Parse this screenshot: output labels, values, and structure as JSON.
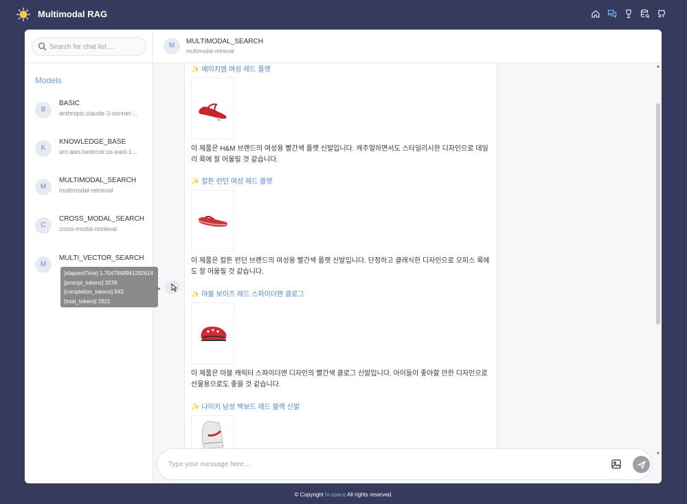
{
  "app": {
    "title": "Multimodal RAG",
    "nav_icons": [
      "home-icon",
      "chat-icon",
      "wine-glass-icon",
      "database-search-icon",
      "github-icon"
    ]
  },
  "sidebar": {
    "search_placeholder": "Search for chat list ...",
    "models_heading": "Models",
    "models": [
      {
        "initial": "B",
        "name": "BASIC",
        "sub": "anthropic.claude-3-sonnet-..."
      },
      {
        "initial": "K",
        "name": "KNOWLEDGE_BASE",
        "sub": "arn:aws:bedrock:us-east-1..."
      },
      {
        "initial": "M",
        "name": "MULTIMODAL_SEARCH",
        "sub": "multimodal-retrieval"
      },
      {
        "initial": "C",
        "name": "CROSS_MODAL_SEARCH",
        "sub": "cross-modal-retrieval"
      },
      {
        "initial": "M",
        "name": "MULTI_VECTOR_SEARCH",
        "sub": ""
      }
    ],
    "tooltip": [
      "[elapsedTime] 1.7047848941292614",
      "[prompt_tokens] 2078",
      "[completion_tokens] 843",
      "[total_tokens] 2921"
    ]
  },
  "chat": {
    "initial": "M",
    "title": "MULTIMODAL_SEARCH",
    "subtitle": "multimodal-retrieval",
    "products": [
      {
        "title": "에이치엠 여성 레드 플랫",
        "desc": "이 제품은 H&M 브랜드의 여성용 빨간색 플랫 신발입니다. 캐주얼하면서도 스타일리시한 디자인으로 데일리 룩에 잘 어울릴 것 같습니다.",
        "image": "red-flat-sandal"
      },
      {
        "title": "칼튼 런던 여성 레드 플랫",
        "desc": "이 제품은 칼튼 런던 브랜드의 여성용 빨간색 플랫 신발입니다. 단정하고 클래식한 디자인으로 오피스 룩에도 잘 어울릴 것 같습니다.",
        "image": "red-flip-flop"
      },
      {
        "title": "마블 보이즈 레드 스파이더맨 클로그",
        "desc": "이 제품은 마블 캐릭터 스파이더맨 디자인의 빨간색 클로그 신발입니다. 아이들이 좋아할 만한 디자인으로 선물용으로도 좋을 것 같습니다.",
        "image": "red-clog"
      },
      {
        "title": "나이키 남성 백보드 레드 블랙 신발",
        "desc": "",
        "image": "high-top-sneaker"
      }
    ],
    "composer_placeholder": "Type your message here..."
  },
  "footer": {
    "prefix": "© Copyright",
    "link": "hi-space",
    "suffix": "All rights reserved."
  }
}
